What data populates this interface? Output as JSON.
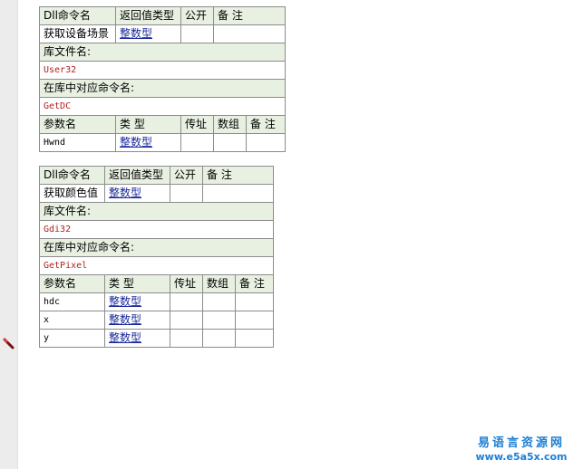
{
  "commands": [
    {
      "header": {
        "name": "Dll命令名",
        "ret": "返回值类型",
        "public": "公开",
        "note": "备 注"
      },
      "name": "获取设备场景",
      "ret_type": "整数型",
      "lib_label": "库文件名:",
      "lib": "User32",
      "entry_label": "在库中对应命令名:",
      "entry": "GetDC",
      "param_header": {
        "name": "参数名",
        "type": "类 型",
        "byref": "传址",
        "array": "数组",
        "note": "备 注"
      },
      "params": [
        {
          "name": "Hwnd",
          "type": "整数型"
        }
      ]
    },
    {
      "header": {
        "name": "Dll命令名",
        "ret": "返回值类型",
        "public": "公开",
        "note": "备 注"
      },
      "name": "获取颜色值",
      "ret_type": "整数型",
      "lib_label": "库文件名:",
      "lib": "Gdi32",
      "entry_label": "在库中对应命令名:",
      "entry": "GetPixel",
      "param_header": {
        "name": "参数名",
        "type": "类 型",
        "byref": "传址",
        "array": "数组",
        "note": "备 注"
      },
      "params": [
        {
          "name": "hdc",
          "type": "整数型"
        },
        {
          "name": "x",
          "type": "整数型"
        },
        {
          "name": "y",
          "type": "整数型"
        }
      ]
    }
  ],
  "watermark": {
    "cn": "易语言资源网",
    "url": "www.e5a5x.com"
  },
  "colors": {
    "header_bg": "#e8f0e2",
    "value_red": "#b02020",
    "type_link": "#1b2a9c",
    "watermark": "#1d7fd4"
  },
  "icons": {
    "cursor": "pen-cursor-icon"
  }
}
